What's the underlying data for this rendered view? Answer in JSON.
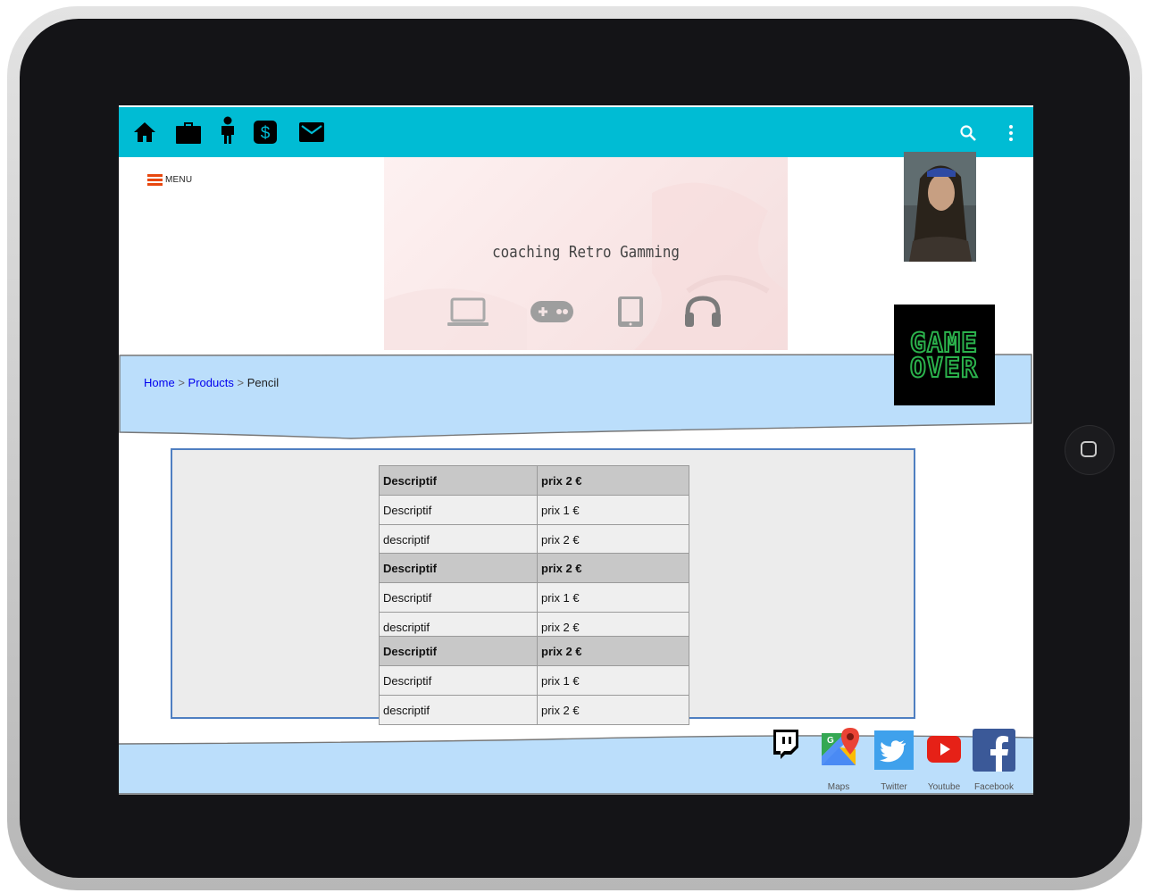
{
  "colors": {
    "topbar": "#00bcd4",
    "accent_menu": "#e8470e",
    "band": "#bbdefb",
    "content_border": "#4f7fc1"
  },
  "topbar": {
    "left_icons": [
      "home-icon",
      "briefcase-icon",
      "person-icon",
      "dollar-icon",
      "mail-icon"
    ],
    "right_icons": [
      "search-icon",
      "more-vert-icon"
    ]
  },
  "menu": {
    "label": "MENU"
  },
  "banner": {
    "title": "coaching Retro Gamming",
    "icons": [
      "laptop-icon",
      "gamepad-icon",
      "tablet-icon",
      "headphones-icon"
    ]
  },
  "breadcrumb": {
    "home": "Home",
    "sep": ">",
    "products": "Products",
    "current": "Pencil"
  },
  "gameover": {
    "line1": "GAME",
    "line2": "OVER"
  },
  "table": {
    "groups": [
      {
        "header": [
          "Descriptif",
          "prix 2 €"
        ],
        "rows": [
          [
            "Descriptif",
            "prix 1 €"
          ],
          [
            "descriptif",
            "prix 2 €"
          ]
        ]
      },
      {
        "header": [
          "Descriptif",
          "prix 2 €"
        ],
        "rows": [
          [
            "Descriptif",
            "prix 1 €"
          ],
          [
            "descriptif",
            "prix 2 €"
          ]
        ]
      },
      {
        "header": [
          "Descriptif",
          "prix 2 €"
        ],
        "rows": [
          [
            "Descriptif",
            "prix 1 €"
          ],
          [
            "descriptif",
            "prix 2 €"
          ]
        ]
      }
    ]
  },
  "footer": {
    "social": [
      {
        "name": "twitch-icon",
        "label": ""
      },
      {
        "name": "maps-icon",
        "label": "Maps"
      },
      {
        "name": "twitter-icon",
        "label": "Twitter"
      },
      {
        "name": "youtube-icon",
        "label": "Youtube"
      },
      {
        "name": "facebook-icon",
        "label": "Facebook"
      }
    ]
  }
}
